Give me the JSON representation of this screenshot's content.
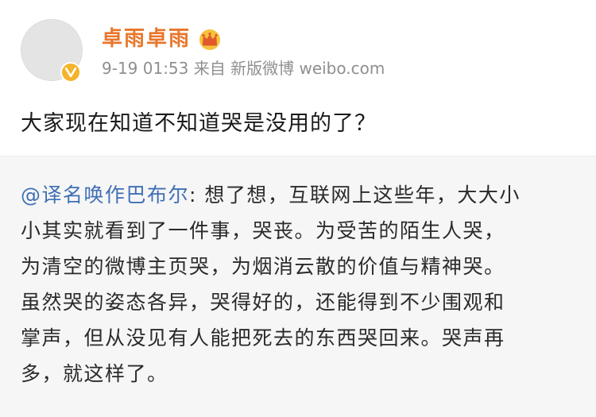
{
  "author": {
    "name": "卓雨卓雨",
    "avatar_icon": "default-avatar",
    "badge_icon": "verified-v-icon",
    "member_icon": "crown-icon"
  },
  "meta": {
    "time": "9-19 01:53",
    "source": "来自 新版微博 weibo.com"
  },
  "post": {
    "text": "大家现在知道不知道哭是没用的了？"
  },
  "repost": {
    "mention": "@译名唤作巴布尔",
    "separator": ": ",
    "lines": [
      "想了想，互联网上这些年，大大小",
      "小其实就看到了一件事，哭丧。为受苦的陌生人哭，",
      "为清空的微博主页哭，为烟消云散的价值与精神哭。",
      "虽然哭的姿态各异，哭得好的，还能得到不少围观和",
      "掌声，但从没见有人能把死去的东西哭回来。哭声再",
      "多，就这样了。"
    ]
  },
  "colors": {
    "username": "#e8762b",
    "mention": "#3f6fb5",
    "repost_bg": "#f6f6f6",
    "meta": "#8f8f8f",
    "badge": "#f3b32a"
  }
}
